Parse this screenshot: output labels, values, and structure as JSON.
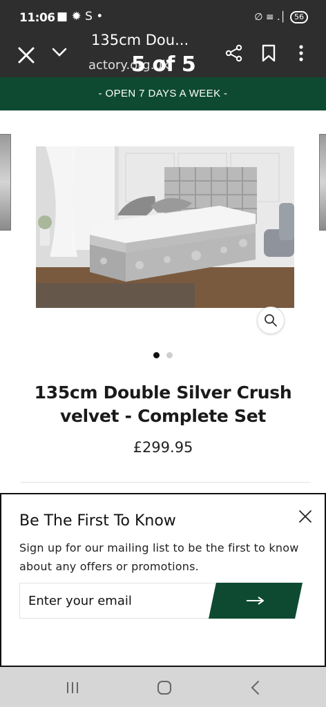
{
  "status_bar": {
    "time": "11:06",
    "left_icons": "■ ✹ S •",
    "signal": "∅ ≡ .│",
    "battery": "56"
  },
  "app_bar": {
    "title": "135cm Dou...",
    "url": "actory.org.uk",
    "page_count": "5 of 5",
    "icons": [
      "close-icon",
      "chevron-down-icon",
      "share-icon",
      "bookmark-icon",
      "more-icon"
    ]
  },
  "promo": {
    "text": "- OPEN 7 DAYS A WEEK -",
    "bg_color": "#0e4a32"
  },
  "product": {
    "title": "135cm Double Silver Crush velvet - Complete Set",
    "price": "£299.95",
    "carousel_count": 2,
    "carousel_active_index": 0
  },
  "newsletter": {
    "title": "Be The First To Know",
    "text": "Sign up for our mailing list to be the first to know about any offers or promotions.",
    "email_placeholder": "Enter your email",
    "submit_icon": "arrow-right-icon",
    "accent": "#0e4a32"
  },
  "nav_bar": {
    "icons": [
      "recent-apps-icon",
      "home-icon",
      "back-icon"
    ]
  }
}
